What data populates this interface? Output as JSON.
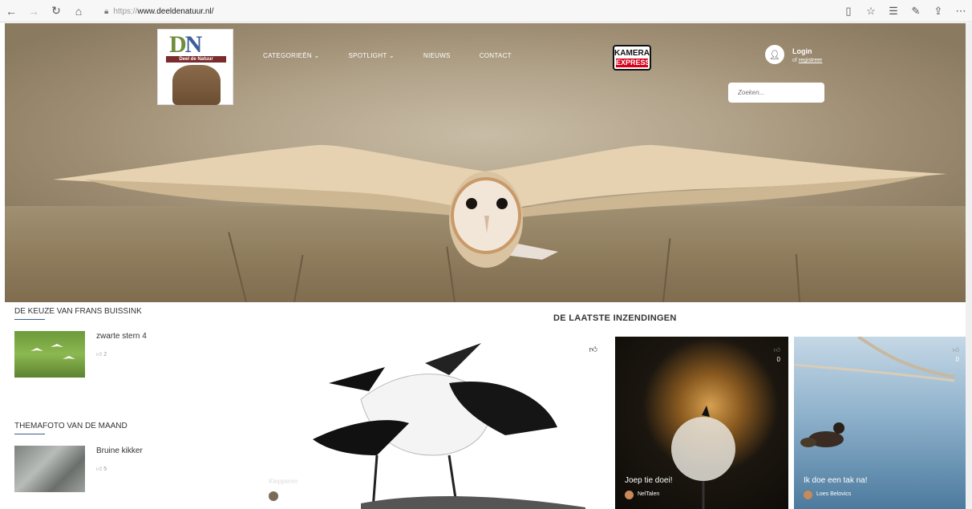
{
  "browser": {
    "url_protocol": "https://",
    "url_host": "www.deeldenatuur.nl/"
  },
  "header": {
    "logo_text": "Deel de Natuur",
    "menu": [
      {
        "label": "CATEGORIEËN ⌄"
      },
      {
        "label": "SPOTLIGHT ⌄"
      },
      {
        "label": "NIEUWS"
      },
      {
        "label": "CONTACT"
      }
    ],
    "sponsor_top": "KAMERA",
    "sponsor_bottom": "EXPRESS",
    "login_label": "Login",
    "register_prefix": "of",
    "register_link": "registreer",
    "search_placeholder": "Zoeken..."
  },
  "sections": {
    "choice": {
      "title": "DE KEUZE VAN FRANS BUISSINK",
      "item_title": "zwarte stern 4",
      "likes": "2"
    },
    "theme": {
      "title": "THEMAFOTO VAN DE MAAND",
      "item_title": "Bruine kikker",
      "likes": "5"
    },
    "latest": {
      "title": "DE LAATSTE INZENDINGEN",
      "featured_caption": "Klepperen",
      "cards": [
        {
          "title": "Joep tie doei!",
          "author": "NelTalen",
          "count": "0"
        },
        {
          "title": "Ik doe een tak na!",
          "author": "Loes Belovics",
          "count": "0"
        }
      ]
    }
  },
  "colors": {
    "accent_line": "#3b5d8c",
    "sponsor_red": "#d6001c"
  }
}
